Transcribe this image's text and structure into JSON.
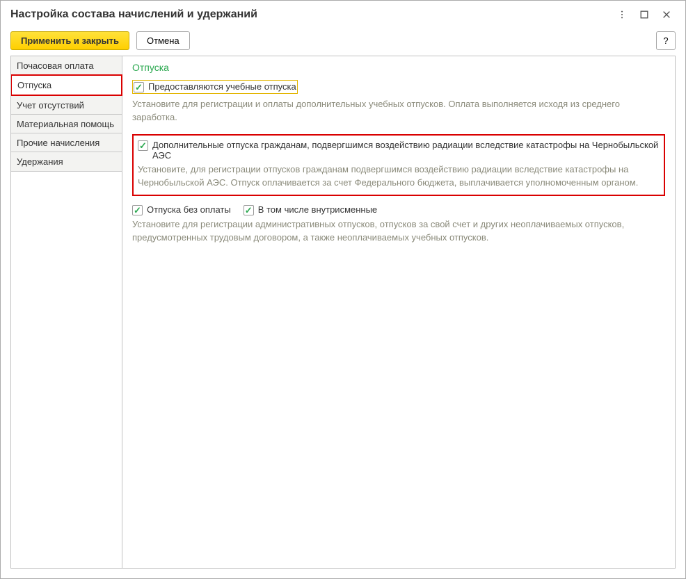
{
  "window": {
    "title": "Настройка состава начислений и удержаний"
  },
  "toolbar": {
    "apply_label": "Применить и закрыть",
    "cancel_label": "Отмена",
    "help_label": "?"
  },
  "sidebar": {
    "items": [
      {
        "label": "Почасовая оплата"
      },
      {
        "label": "Отпуска"
      },
      {
        "label": "Учет отсутствий"
      },
      {
        "label": "Материальная помощь"
      },
      {
        "label": "Прочие начисления"
      },
      {
        "label": "Удержания"
      }
    ],
    "active_index": 1
  },
  "content": {
    "section_title": "Отпуска",
    "option1": {
      "label": "Предоставляются учебные отпуска",
      "desc": "Установите для регистрации и оплаты дополнительных учебных отпусков. Оплата выполняется исходя из среднего заработка.",
      "checked": true
    },
    "option2": {
      "label": "Дополнительные отпуска гражданам, подвергшимся воздействию радиации вследствие катастрофы на Чернобыльской АЭС",
      "desc": "Установите, для регистрации отпусков гражданам подвергшимся воздействию радиации вследствие катастрофы на Чернобыльской АЭС. Отпуск оплачивается за счет Федерального бюджета, выплачивается уполномоченным органом.",
      "checked": true
    },
    "option3a": {
      "label": "Отпуска без оплаты",
      "checked": true
    },
    "option3b": {
      "label": "В том числе внутрисменные",
      "checked": true
    },
    "option3_desc": "Установите для регистрации административных отпусков, отпусков за свой счет и других неоплачиваемых отпусков, предусмотренных трудовым договором, а также неоплачиваемых учебных отпусков."
  }
}
